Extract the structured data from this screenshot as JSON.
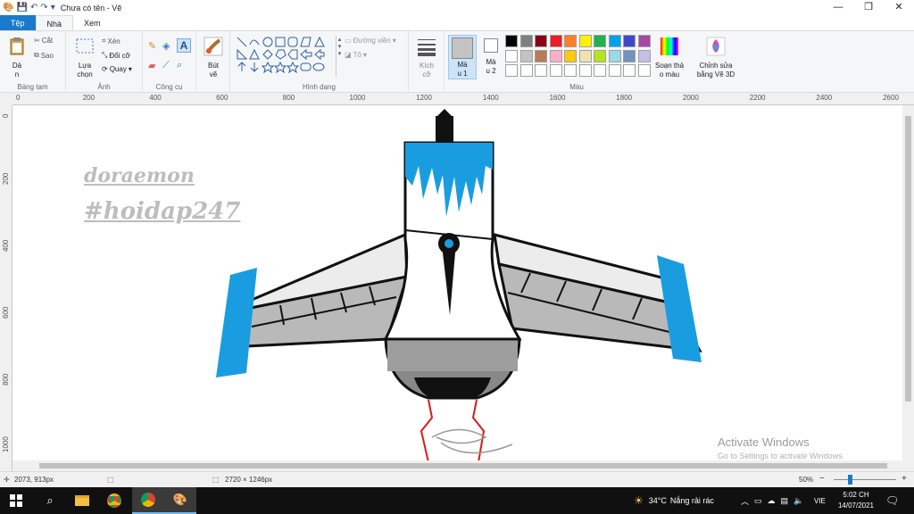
{
  "window": {
    "title": "Chưa có tên - Vẽ",
    "minimize": "—",
    "maximize": "❐",
    "close": "✕"
  },
  "tabs": [
    {
      "label": "Tệp"
    },
    {
      "label": "Nhà"
    },
    {
      "label": "Xem"
    }
  ],
  "ribbon": {
    "clipboard": {
      "paste": "Dá",
      "paste2": "n",
      "cut": "Cắt",
      "copy": "Sao",
      "group": "Bảng tạm"
    },
    "image": {
      "select": "Lựa",
      "select2": "chọn",
      "crop": "Xén",
      "resize": "Đổi cỡ",
      "rotate": "Quay",
      "group": "Ảnh"
    },
    "tools": {
      "group": "Công cụ"
    },
    "brushes": {
      "label": "Bút",
      "label2": "vẽ"
    },
    "shapes": {
      "outline": "Đường viền",
      "fill": "Tô",
      "group": "Hình dạng"
    },
    "size": {
      "label": "Kích",
      "label2": "cỡ"
    },
    "color1": {
      "label": "Mà",
      "label2": "u 1"
    },
    "color2": {
      "label": "Mà",
      "label2": "u 2"
    },
    "colors": {
      "group": "Màu"
    },
    "edit_colors": {
      "label": "Soạn thả",
      "label2": "o màu"
    },
    "paint3d": {
      "label": "Chỉnh sửa",
      "label2": "bằng Vẽ 3D"
    }
  },
  "palette": {
    "row1": [
      "#000000",
      "#7f7f7f",
      "#880015",
      "#ed1c24",
      "#ff7f27",
      "#fff200",
      "#22b14c",
      "#00a2e8",
      "#3f48cc",
      "#a349a4"
    ],
    "row2": [
      "#ffffff",
      "#c3c3c3",
      "#b97a57",
      "#ffaec9",
      "#ffc90e",
      "#efe4b0",
      "#b5e61d",
      "#99d9ea",
      "#7092be",
      "#c8bfe7"
    ]
  },
  "ruler": {
    "top": [
      "0",
      "200",
      "400",
      "600",
      "800",
      "1000",
      "1200",
      "1400",
      "1600",
      "1800",
      "2000",
      "2200",
      "2400",
      "2600"
    ],
    "left": [
      "0",
      "200",
      "400",
      "600",
      "800",
      "1000"
    ]
  },
  "canvas": {
    "watermark1": "doraemon",
    "watermark2": "#hoidap247"
  },
  "statusbar": {
    "cursor": "2073, 913px",
    "size": "2720 × 1246px",
    "zoom": "50%",
    "zoom_minus": "−",
    "zoom_plus": "+"
  },
  "activate": {
    "title": "Activate Windows",
    "subtitle": "Go to Settings to activate Windows."
  },
  "taskbar": {
    "weather_temp": "34°C",
    "weather_text": "Nắng rải rác",
    "lang": "VIE",
    "time": "5:02 CH",
    "date": "14/07/2021"
  }
}
